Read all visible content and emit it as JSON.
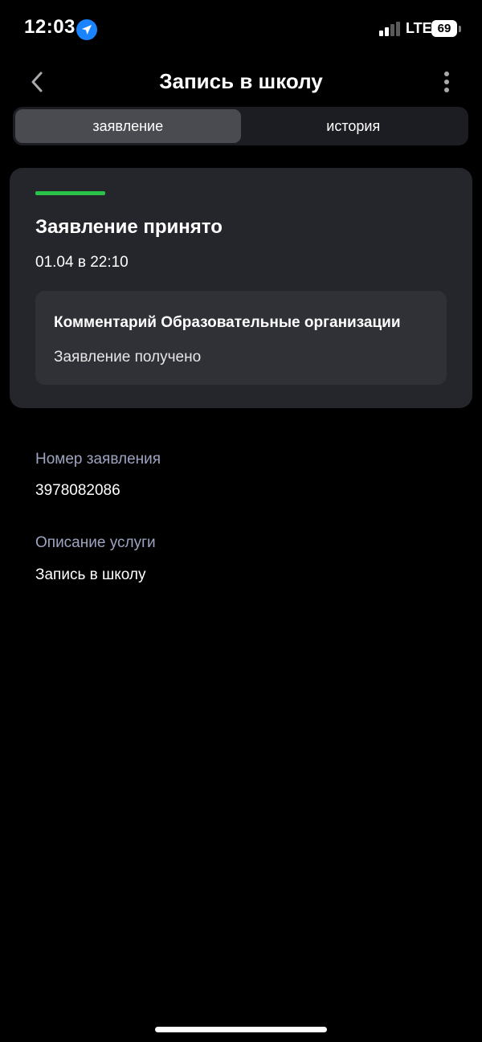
{
  "status_bar": {
    "time": "12:03",
    "network": "LTE",
    "battery": "69"
  },
  "header": {
    "title": "Запись в школу"
  },
  "tabs": [
    {
      "label": "заявление",
      "active": true
    },
    {
      "label": "история",
      "active": false
    }
  ],
  "status_card": {
    "progress_color": "#2bc24a",
    "title": "Заявление принято",
    "date": "01.04 в 22:10",
    "comment": {
      "title": "Комментарий Образовательные организации",
      "text": "Заявление получено"
    }
  },
  "fields": [
    {
      "label": "Номер заявления",
      "value": "3978082086"
    },
    {
      "label": "Описание услуги",
      "value": "Запись в школу"
    }
  ],
  "icons": {
    "back": "chevron-left-icon",
    "more": "more-vertical-icon",
    "location": "location-arrow-icon",
    "signal": "signal-icon"
  },
  "colors": {
    "accent_green": "#2bc24a",
    "location_blue": "#1a84ff",
    "label_muted": "#9ea4c0"
  }
}
